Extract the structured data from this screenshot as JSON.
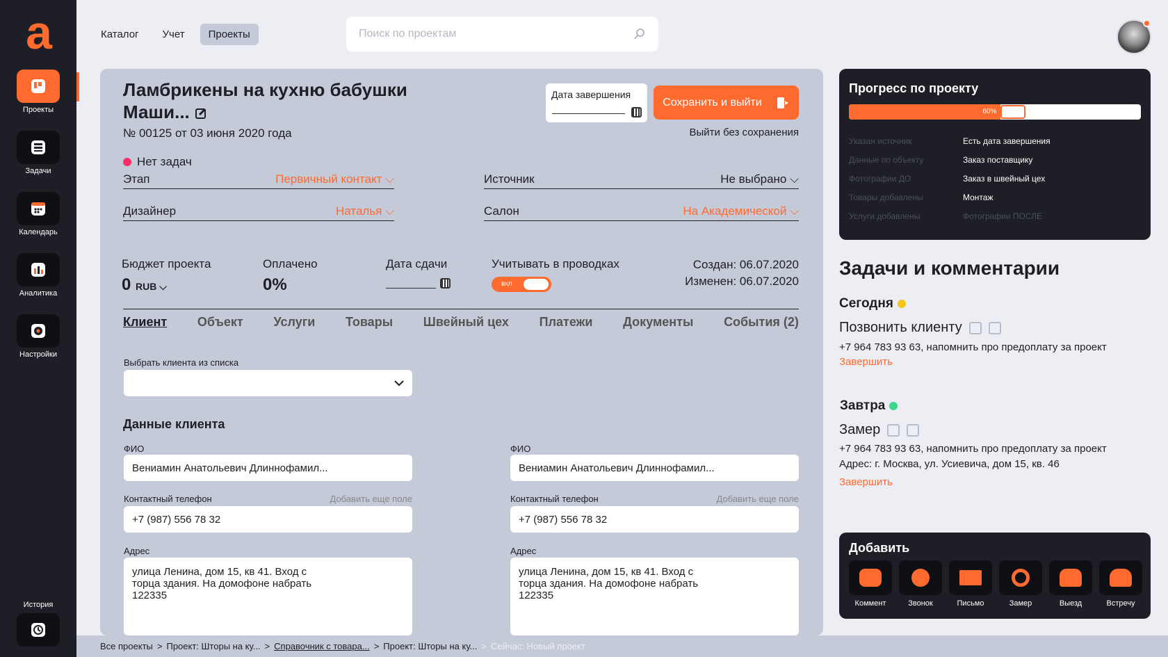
{
  "sidebar": {
    "logo": "a",
    "items": [
      {
        "label": "Проекты",
        "icon": "projects-icon"
      },
      {
        "label": "Задачи",
        "icon": "tasks-icon"
      },
      {
        "label": "Календарь",
        "icon": "calendar-icon"
      },
      {
        "label": "Аналитика",
        "icon": "analytics-icon"
      },
      {
        "label": "Настройки",
        "icon": "settings-icon"
      }
    ],
    "history": {
      "label": "История",
      "icon": "history-icon"
    }
  },
  "topnav": {
    "items": [
      "Каталог",
      "Учет",
      "Проекты"
    ],
    "selected": "Проекты"
  },
  "search": {
    "placeholder": "Поиск по проектам",
    "icon": "search-icon"
  },
  "project": {
    "title": "Ламбрикены на кухню бабушки Маши...",
    "number_line": "№ 00125  от 03 июня 2020 года",
    "due_label": "Дата завершения",
    "save_label": "Сохранить и выйти",
    "exit_label": "Выйти без сохранения",
    "no_tasks": "Нет задач",
    "stage_label": "Этап",
    "stage_value": "Первичный контакт",
    "source_label": "Источник",
    "source_value": "Не выбрано",
    "designer_label": "Дизайнер",
    "designer_value": "Наталья",
    "salon_label": "Салон",
    "salon_value": "На Академической",
    "budget_label": "Бюджет проекта",
    "budget_value": "0",
    "budget_currency": "RUB",
    "paid_label": "Оплачено",
    "paid_value": "0%",
    "handover_label": "Дата сдачи",
    "postings_label": "Учитывать в проводках",
    "toggle_label": "вкл",
    "created": "Создан: 06.07.2020",
    "modified": "Изменен: 06.07.2020"
  },
  "tabs": [
    "Клиент",
    "Объект",
    "Услуги",
    "Товары",
    "Швейный цех",
    "Платежи",
    "Документы",
    "События (2)"
  ],
  "client": {
    "choose_label": "Выбрать клиента из списка",
    "section_title": "Данные клиента",
    "fio_label": "ФИО",
    "fio_value": "Вениамин Анатольевич Длиннофамил...",
    "phone_label": "Контактный телефон",
    "add_field": "Добавить еще поле",
    "phone_value": "+7 (987) 556 78 32",
    "address_label": "Адрес",
    "address_value": "улица Ленина, дом 15, кв 41. Вход с\nторца здания. На домофоне набрать\n122335"
  },
  "breadcrumb": [
    "Все проекты",
    "Проект: Шторы на ку...",
    "Справочник с товара...",
    "Проект: Шторы на ку...",
    "Сейчас: Новый проект"
  ],
  "progress": {
    "title": "Прогресс по проекту",
    "percent": 0.6,
    "percent_label": "60%",
    "checklist_left": [
      "Указан источник",
      "Данные по объекту",
      "Фотографии ДО",
      "Товары добавлены",
      "Услуги добавлены"
    ],
    "checklist_right": [
      "Есть дата завершения",
      "Заказ поставщику",
      "Заказ в швейный цех",
      "Монтаж",
      "Фотографии ПОСЛЕ"
    ],
    "checklist_right_done": [
      true,
      true,
      true,
      true,
      false
    ]
  },
  "tasks": {
    "title": "Задачи и комментарии",
    "today_label": "Сегодня",
    "today_color": "#f5c518",
    "today_task": "Позвонить клиенту",
    "today_desc": "+7 964 783 93 63, напомнить про предоплату за проект",
    "finish": "Завершить",
    "tomorrow_label": "Завтра",
    "tomorrow_color": "#3dd68c",
    "tomorrow_task": "Замер",
    "tomorrow_desc": "+7 964 783 93 63, напомнить про предоплату за проект",
    "tomorrow_addr": "Адрес: г. Москва, ул. Усиевича, дом 15, кв. 46"
  },
  "add": {
    "title": "Добавить",
    "items": [
      "Коммент",
      "Звонок",
      "Письмо",
      "Замер",
      "Выезд",
      "Встречу"
    ]
  },
  "colors": {
    "accent": "#ff6a2f",
    "dark": "#1e1f26",
    "card": "#c5cad9",
    "no_tasks_dot": "#ff2d6a"
  }
}
